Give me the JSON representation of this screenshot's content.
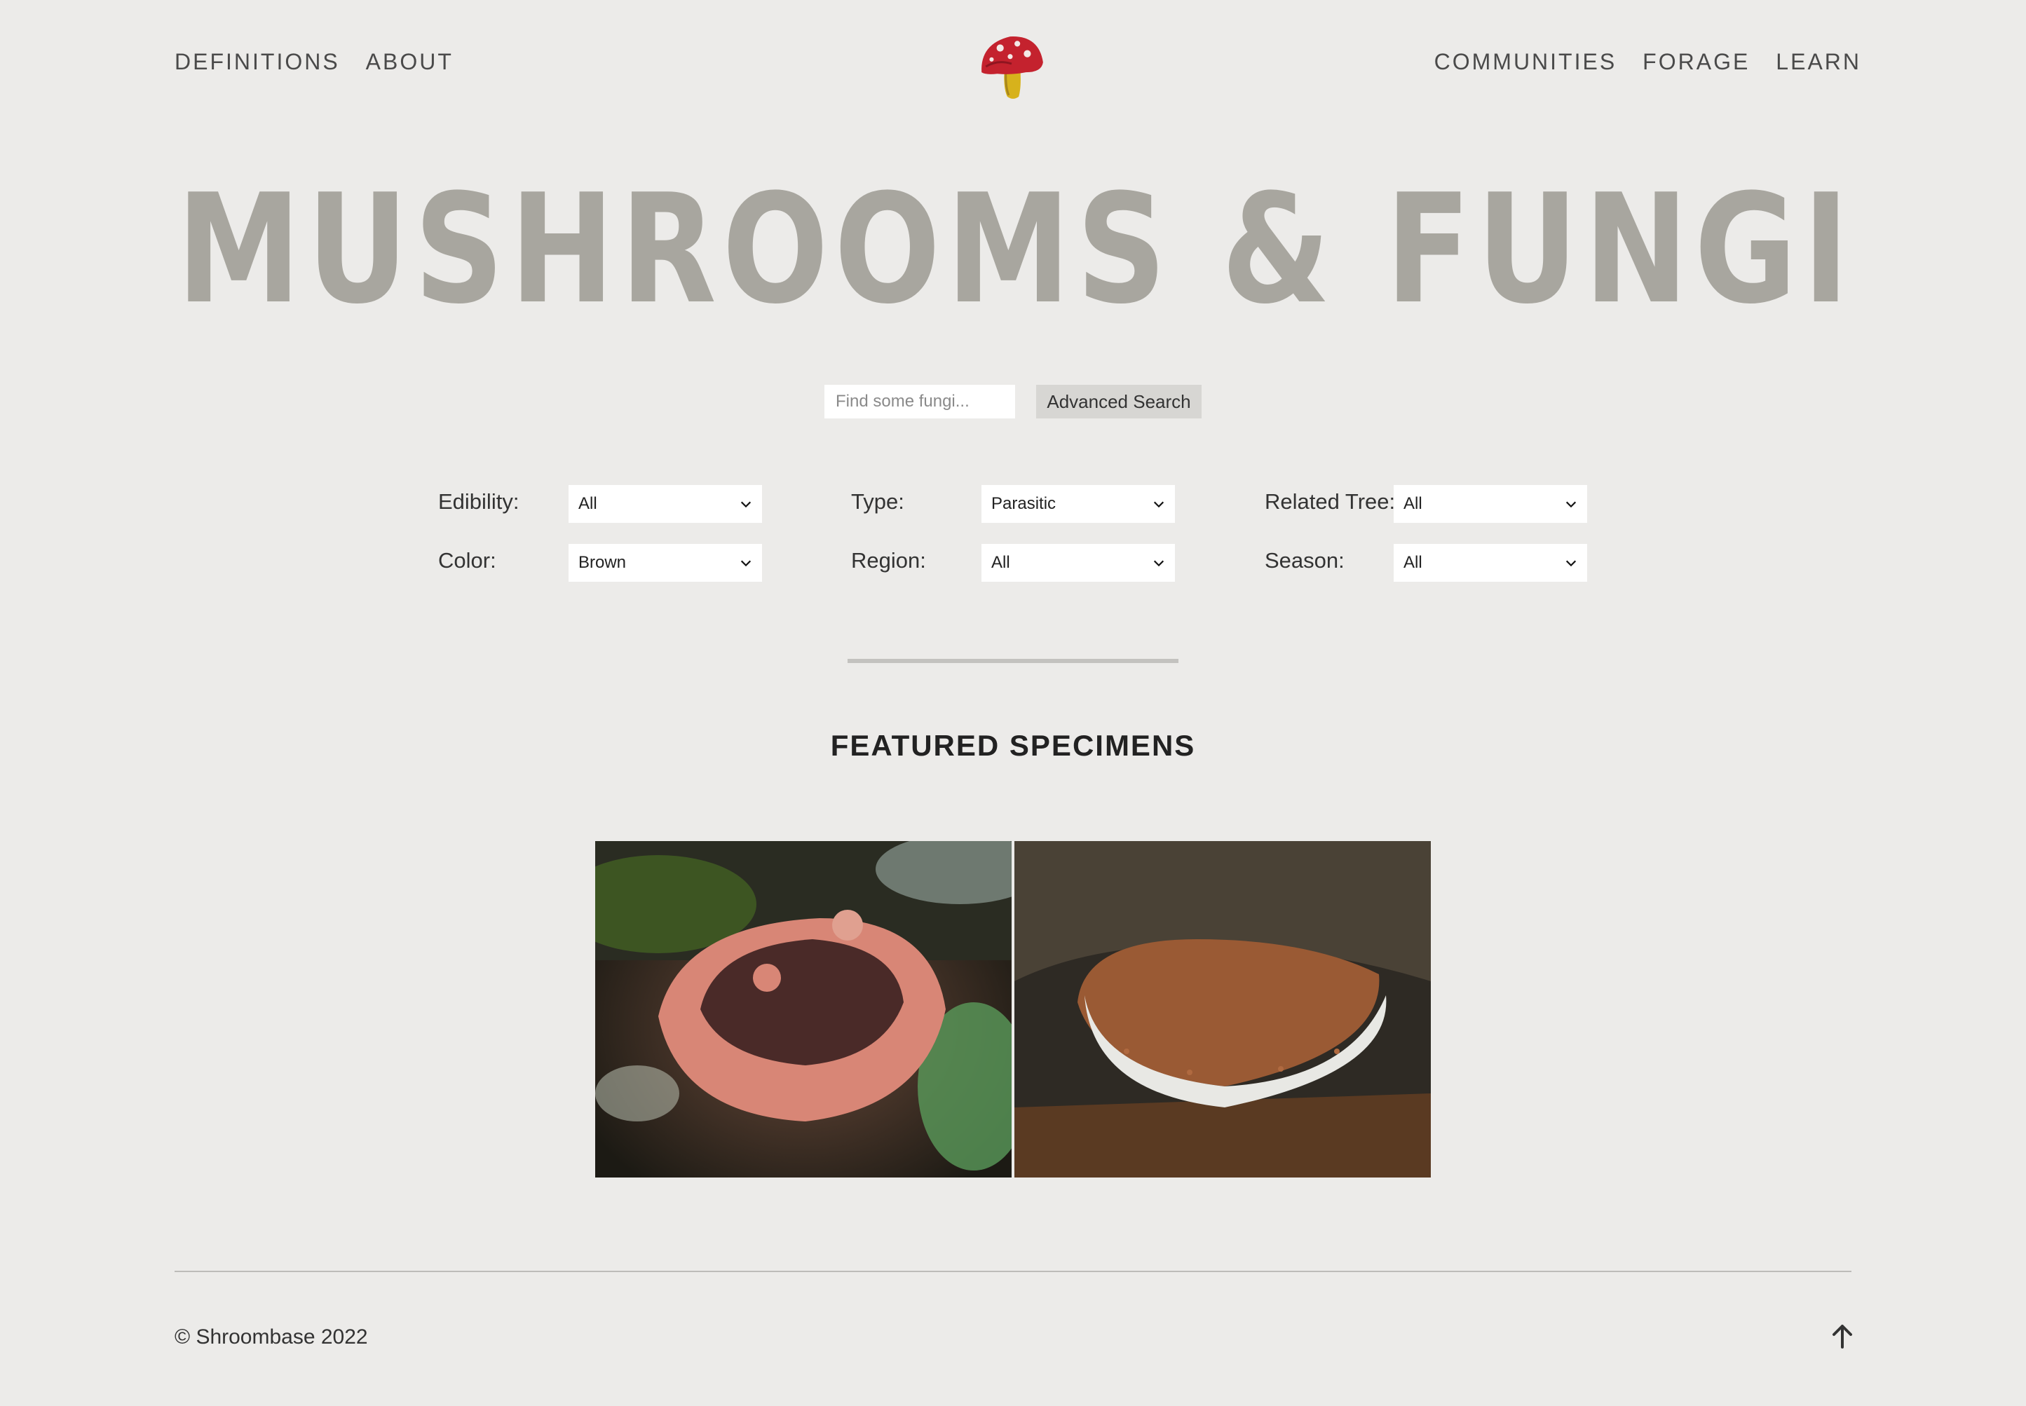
{
  "nav": {
    "left": [
      "DEFINITIONS",
      "ABOUT"
    ],
    "right": [
      "COMMUNITIES",
      "FORAGE",
      "LEARN"
    ]
  },
  "hero": {
    "title": "MUSHROOMS & FUNGI"
  },
  "search": {
    "placeholder": "Find some fungi...",
    "value": "",
    "advanced_label": "Advanced Search"
  },
  "filters": {
    "edibility": {
      "label": "Edibility:",
      "value": "All"
    },
    "type": {
      "label": "Type:",
      "value": "Parasitic"
    },
    "related_tree": {
      "label": "Related Tree:",
      "value": "All"
    },
    "color": {
      "label": "Color:",
      "value": "Brown"
    },
    "region": {
      "label": "Region:",
      "value": "All"
    },
    "season": {
      "label": "Season:",
      "value": "All"
    }
  },
  "featured": {
    "title": "FEATURED SPECIMENS"
  },
  "footer": {
    "copyright": "© Shroombase 2022"
  },
  "icons": {
    "logo": "mushroom-logo-icon",
    "chevron": "chevron-down-icon",
    "back_to_top": "arrow-up-icon"
  },
  "colors": {
    "background": "#ecebe9",
    "title": "#a8a69f",
    "logo_cap": "#c4222e",
    "logo_stem": "#d7b21c"
  }
}
